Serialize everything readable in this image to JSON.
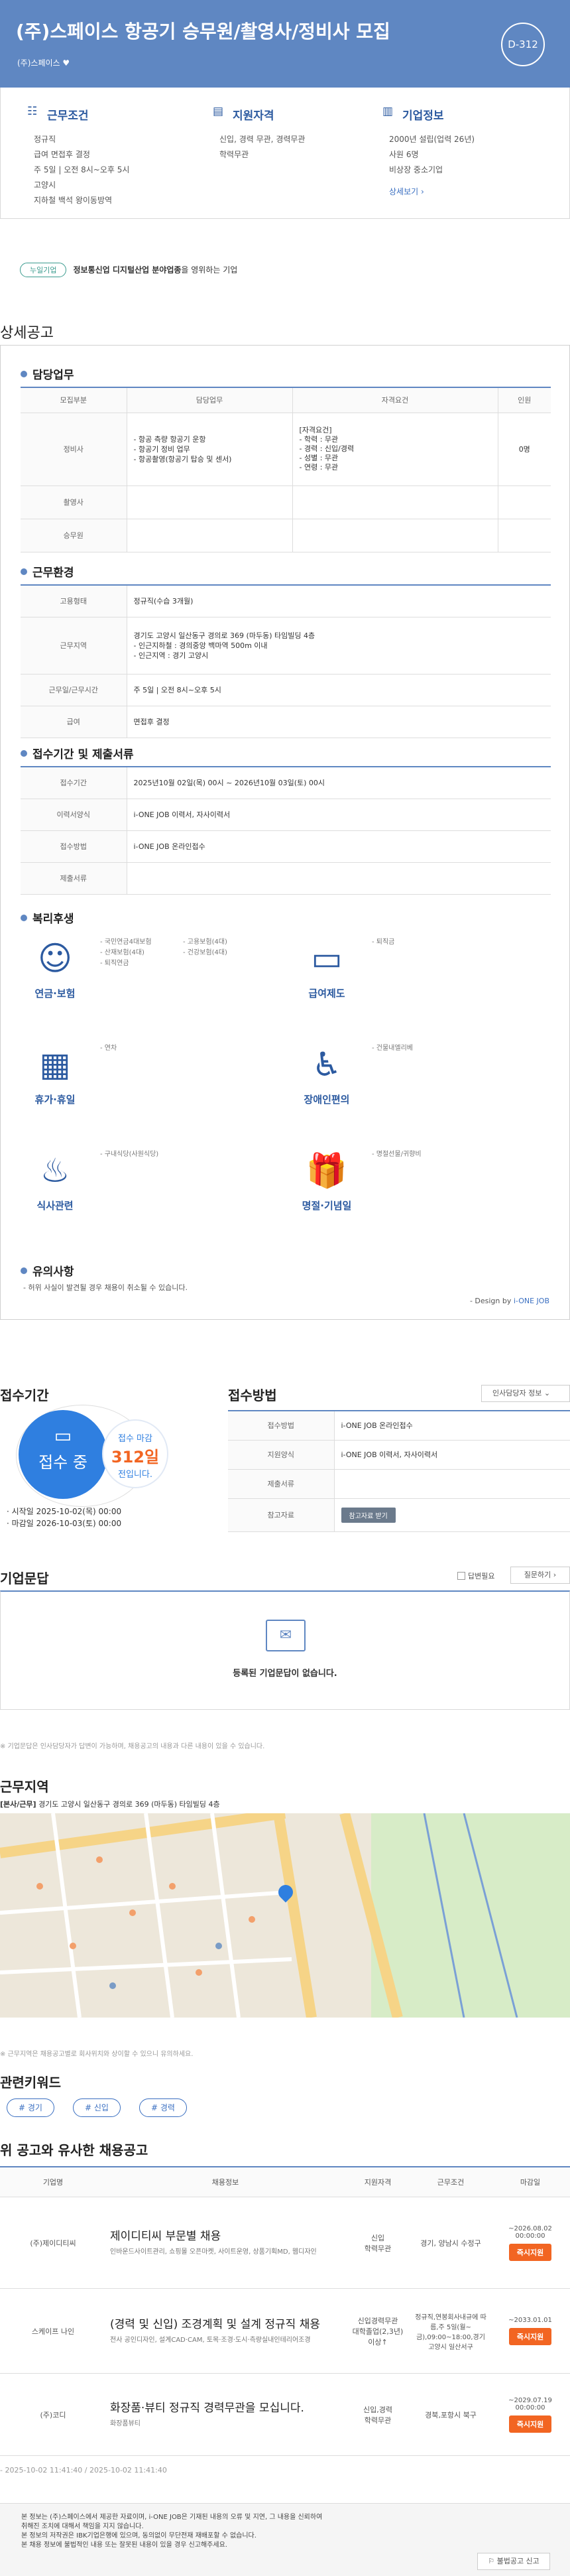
{
  "header": {
    "title": "(주)스페이스 항공기 승무원/촬영사/정비사 모집",
    "company": "(주)스페이스",
    "heart": "♥",
    "dday": "D-312"
  },
  "summary": {
    "conditions": {
      "title": "근무조건",
      "lines": [
        "정규직",
        "급여 면접후 결정",
        "주 5일 | 오전 8시~오후 5시",
        "고양시",
        "지하철 백석 왕이동방역"
      ]
    },
    "qualification": {
      "title": "지원자격",
      "lines": [
        "신입, 경력 무관, 경력무관",
        "학력무관"
      ]
    },
    "company": {
      "title": "기업정보",
      "lines": [
        "2000년 설립(업력 26년)",
        "사원 6명",
        "비상장 중소기업"
      ],
      "link": "상세보기 ›"
    }
  },
  "notice": {
    "pill": "누일기업",
    "text": "정보통신업 디지털산업 분야업종",
    "suffix": "을 영위하는 기업"
  },
  "detail": {
    "section_title": "상세공고",
    "duty": {
      "title": "담당업무",
      "headers": [
        "모집부분",
        "담당업무",
        "자격요건",
        "인원"
      ],
      "rows": [
        {
          "part": "정비사",
          "duty": [
            "- 항공 측량 항공기 운항",
            "- 항공기 정비 업무",
            "- 항공촬영(항공기 탑승 및 센서)"
          ],
          "req": [
            "[자격요건]",
            "- 학력 : 무관",
            "- 경력 : 신입/경력",
            "- 성별 : 무관",
            "- 연령 : 무관"
          ],
          "count": "0명"
        },
        {
          "part": "촬영사",
          "duty": [],
          "req": [],
          "count": ""
        },
        {
          "part": "승무원",
          "duty": [],
          "req": [],
          "count": ""
        }
      ]
    },
    "environment": {
      "title": "근무환경",
      "rows": [
        {
          "label": "고용형태",
          "value": [
            "정규직(수습 3개월)"
          ]
        },
        {
          "label": "근무지역",
          "value": [
            "경기도 고양시 일산동구 경의로 369 (마두동) 타임빌딩 4층",
            "- 인근지하철 : 경의중앙 백마역 500m 이내",
            "- 인근지역 : 경기 고양시"
          ]
        },
        {
          "label": "근무일/근무시간",
          "value": [
            "주 5일 | 오전 8시~오후 5시"
          ]
        },
        {
          "label": "급여",
          "value": [
            "면접후 결정"
          ]
        }
      ]
    },
    "apply": {
      "title": "접수기간 및 제출서류",
      "rows": [
        {
          "label": "접수기간",
          "value": "2025년10월 02일(목) 00시 ~ 2026년10월 03일(토) 00시"
        },
        {
          "label": "이력서양식",
          "value": "i-ONE JOB 이력서, 자사이력서"
        },
        {
          "label": "접수방법",
          "value": "i-ONE JOB 온라인접수"
        },
        {
          "label": "제출서류",
          "value": ""
        }
      ]
    },
    "benefits": {
      "title": "복리후생",
      "items": [
        {
          "icon": "pension-icon",
          "glyph": "☺",
          "name": "연금·보험",
          "list": [
            "- 국민연금4대보험",
            "- 고용보험(4대)",
            "- 산재보험(4대)",
            "- 건강보험(4대)",
            "- 퇴직연금"
          ]
        },
        {
          "icon": "salary-icon",
          "glyph": "▭",
          "name": "급여제도",
          "list": [
            "- 퇴직금"
          ]
        },
        {
          "icon": "vacation-icon",
          "glyph": "▦",
          "name": "휴가·휴일",
          "list": [
            "- 연차"
          ]
        },
        {
          "icon": "accessibility-icon",
          "glyph": "♿",
          "name": "장애인편의",
          "list": [
            "- 건물내엘리베"
          ]
        },
        {
          "icon": "meal-icon",
          "glyph": "♨",
          "name": "식사관련",
          "list": [
            "- 구내식당(사원식당)"
          ]
        },
        {
          "icon": "gift-icon",
          "glyph": "🎁",
          "name": "명절·기념일",
          "list": [
            "- 명절선물/귀향비"
          ]
        }
      ]
    },
    "caution": {
      "title": "유의사항",
      "text": "- 허위 사실이 발견될 경우 채용이 취소될 수 있습니다.",
      "design_prefix": "- Design by ",
      "design_brand": "i-ONE JOB"
    }
  },
  "period": {
    "title": "접수기간",
    "status": "접수 중",
    "left_prefix": "접수 마감",
    "days": "312일",
    "left_suffix": "전입니다.",
    "start": "· 시작일 2025-10-02(목) 00:00",
    "end": "· 마감일 2026-10-03(토) 00:00"
  },
  "method": {
    "title": "접수방법",
    "dropdown": "인사담당자 정보",
    "rows": [
      {
        "label": "접수방법",
        "value": "i-ONE JOB 온라인접수"
      },
      {
        "label": "지원양식",
        "value": "i-ONE JOB 이력서, 자사이력서"
      },
      {
        "label": "제출서류",
        "value": ""
      },
      {
        "label": "참고자료",
        "value": ""
      }
    ],
    "download": "참고자료 받기"
  },
  "qna": {
    "title": "기업문답",
    "check": "답변필요",
    "button": "질문하기",
    "empty": "등록된 기업문답이 없습니다.",
    "note": "※ 기업문답은 인사담당자가 답변이 가능하며, 채용공고의 내용과 다른 내용이 있을 수 있습니다."
  },
  "location": {
    "title": "근무지역",
    "address_label": "[본사/근무]",
    "address": "경기도 고양시 일산동구 경의로 369 (마두동) 타임빌딩 4층",
    "note": "※ 근무지역은 채용공고별로 회사위치와 상이할 수 있으니 유의하세요."
  },
  "keywords": {
    "title": "관련키워드",
    "items": [
      "# 경기",
      "# 신입",
      "# 경력"
    ]
  },
  "similar": {
    "title": "위 공고와 유사한 채용공고",
    "headers": [
      "기업명",
      "채용정보",
      "지원자격",
      "근무조건",
      "마감일"
    ],
    "rows": [
      {
        "company": "(주)제이디티씨",
        "title": "제이디티씨 부문별 채용",
        "sub": "인바운드사이트관리, 쇼핑몰 오픈마켓, 사이트운영, 상품기획MD, 웹디자인",
        "qual": "신입\n학력무관",
        "cond": "경기, 양남시 수정구",
        "deadline": "~2026.08.02 00:00:00",
        "btn": "즉시지원"
      },
      {
        "company": "스케이프 나인",
        "title": "(경력 및 신입) 조경계획 및 설계 정규직 채용",
        "sub": "전사 공인디자인, 설계CAD·CAM, 토목·조경·도시·측량실내인테리어조경",
        "qual": "신입경력무관\n대학졸업(2,3년)\n이상↑",
        "cond": "정규직,연봉회사내규에 따름,주 5일(월~금),09:00~18:00,경기 고양시 일산서구",
        "deadline": "~2033.01.01",
        "btn": "즉시지원"
      },
      {
        "company": "(주)코디",
        "title": "화장품·뷰티 정규직 경력무관을 모십니다.",
        "sub": "화장품뷰티",
        "qual": "신입,경력\n학력무관",
        "cond": "경북,포항시 북구",
        "deadline": "~2029.07.19 00:00:00",
        "btn": "즉시지원"
      }
    ],
    "dates": "- 2025-10-02 11:41:40 / 2025-10-02 11:41:40"
  },
  "footer": {
    "lines": [
      "본 정보는 (주)스페이스에서 제공한 자료이며, i-ONE JOB은 기재된 내용의 오류 및 지연, 그 내용을 신뢰하여",
      "취해진 조치에 대해서 책임을 지지 않습니다.",
      "본 정보의 저작권은 IBK기업은행에 있으며, 동의없이 무단전재 재배포할 수 없습니다.",
      "본 채용 정보에 불법적인 내용 또는 잘못된 내용이 있을 경우 신고해주세요."
    ],
    "report": "불법공고 신고"
  }
}
